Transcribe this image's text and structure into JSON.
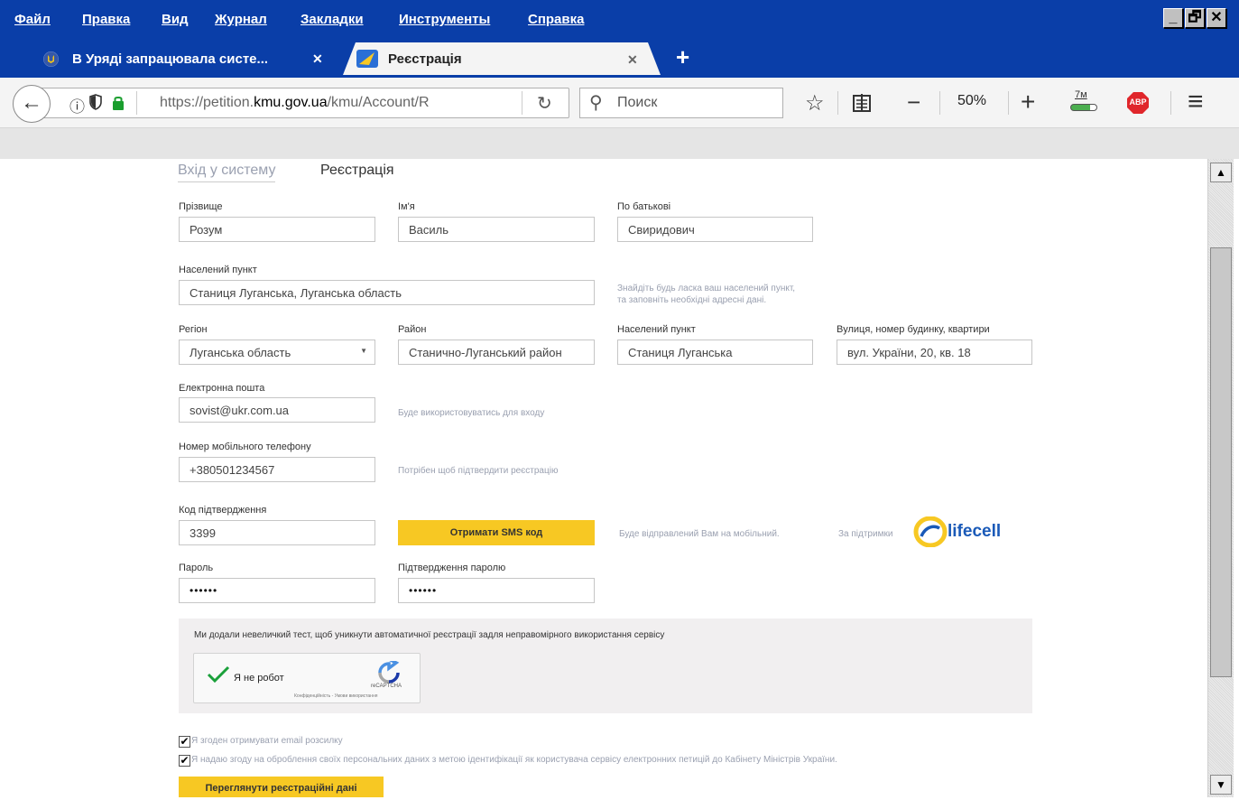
{
  "menu": {
    "items": [
      "Файл",
      "Правка",
      "Вид",
      "Журнал",
      "Закладки",
      "Инструменты",
      "Справка"
    ],
    "window_buttons": [
      "_",
      "🗗",
      "✕"
    ]
  },
  "tabs": [
    {
      "title": "В Уряді запрацювала систе...",
      "close": "✕"
    },
    {
      "title": "Реєстрація",
      "close": "✕"
    }
  ],
  "new_tab": "+",
  "nav": {
    "back": "←",
    "url_prefix": "https://petition.",
    "url_domain": "kmu.gov.ua",
    "url_suffix": "/kmu/Account/R",
    "reload": "↻",
    "search_placeholder": "Поиск",
    "zoom_minus": "−",
    "zoom": "50%",
    "zoom_plus": "+",
    "badge_7m": "7м",
    "abp": "ABP",
    "menu": "≡"
  },
  "form": {
    "tab_login": "Вхід у систему",
    "tab_register": "Реєстрація",
    "surname_label": "Прізвище",
    "surname_value": "Розум",
    "name_label": "Ім'я",
    "name_value": "Василь",
    "patronymic_label": "По батькові",
    "patronymic_value": "Свиридович",
    "locality_label": "Населений пункт",
    "locality_value": "Станиця Луганська, Луганська область",
    "locality_hint_1": "Знайдіть будь ласка ваш населений пункт,",
    "locality_hint_2": "та заповніть необхідні адресні дані.",
    "region_label": "Регіон",
    "region_value": "Луганська область",
    "district_label": "Район",
    "district_value": "Станично-Луганський район",
    "locality2_label": "Населений пункт",
    "locality2_value": "Станиця Луганська",
    "street_label": "Вулиця, номер будинку, квартири",
    "street_value": "вул. України, 20, кв. 18",
    "email_label": "Електронна пошта",
    "email_value": "sovist@ukr.com.ua",
    "email_hint": "Буде використовуватись для входу",
    "phone_label": "Номер мобільного телефону",
    "phone_value": "+380501234567",
    "phone_hint": "Потрібен щоб підтвердити реєстрацію",
    "code_label": "Код підтвердження",
    "code_value": "3399",
    "sms_button": "Отримати SMS код",
    "sms_hint": "Буде відправлений Вам на мобільний.",
    "support_text": "За підтримки",
    "lifecell": "lifecell",
    "password_label": "Пароль",
    "password_value": "••••••",
    "password_confirm_label": "Підтвердження паролю",
    "password_confirm_value": "••••••",
    "captcha_text": "Ми додали невеличкий тест, щоб уникнути автоматичної реєстрації задля неправомірного використання сервісу",
    "recaptcha_label": "Я не робот",
    "recaptcha_brand": "reCAPTCHA",
    "recaptcha_links": "Конфіденційність - Умови використання",
    "checkbox1_label": "Я згоден отримувати email розсилку",
    "checkbox2_label": "Я надаю згоду на оброблення своїх персональних даних з метою ідентифікації як користувача сервісу електронних петицій до Кабінету Міністрів України.",
    "review_button": "Переглянути реєстраційні дані"
  },
  "colors": {
    "chrome_blue": "#0a3ea8",
    "accent_yellow": "#f7c823",
    "hint_grey": "#9aa0b0"
  }
}
